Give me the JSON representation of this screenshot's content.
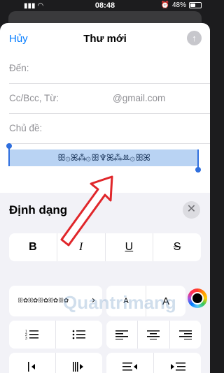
{
  "status": {
    "time": "08:48",
    "battery": "48%"
  },
  "nav": {
    "cancel": "Hủy",
    "title": "Thư mới",
    "send": "↑"
  },
  "fields": [
    {
      "label": "Đến:",
      "value": ""
    },
    {
      "label": "Cc/Bcc, Từ:",
      "value": "@gmail.com"
    },
    {
      "label": "Chủ đề:",
      "value": ""
    }
  ],
  "body": {
    "selected_text": "ꕥ۞ꕤ⁂۞ꕥ♆ꕤ⁂ꔛ۞ꕥꕤ"
  },
  "format": {
    "title": "Định dạng",
    "close": "✕",
    "style_buttons": [
      "B",
      "I",
      "U",
      "S"
    ],
    "font_preview": "ꕥ✿ꕤ✿ꕥ✿ꕤ✿ꕥ✿",
    "font_chevron": "›",
    "size_small": "A",
    "size_large": "A",
    "watermark": "Quantrimang"
  }
}
